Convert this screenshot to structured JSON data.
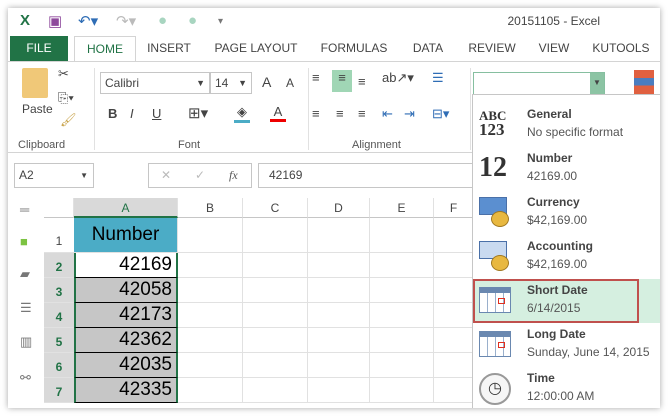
{
  "title": "20151105 - Excel",
  "tabs": [
    "FILE",
    "HOME",
    "INSERT",
    "PAGE LAYOUT",
    "FORMULAS",
    "DATA",
    "REVIEW",
    "VIEW",
    "KUTOOLS"
  ],
  "ribbon": {
    "paste_label": "Paste",
    "groups": [
      "Clipboard",
      "Font",
      "Alignment"
    ],
    "font_name": "Calibri",
    "font_size": "14",
    "bold": "B",
    "italic": "I",
    "underline": "U",
    "font_color_glyph": "A",
    "grow": "A",
    "shrink": "A",
    "number_format_value": ""
  },
  "formula_bar": {
    "name_box": "A2",
    "fx": "fx",
    "cancel": "✕",
    "enter": "✓",
    "value": "42169"
  },
  "grid": {
    "columns": [
      "A",
      "B",
      "C",
      "D",
      "E",
      "F"
    ],
    "rows": [
      "1",
      "2",
      "3",
      "4",
      "5",
      "6",
      "7"
    ],
    "header_cell": "Number",
    "values": [
      "42169",
      "42058",
      "42173",
      "42362",
      "42035",
      "42335"
    ]
  },
  "format_menu": [
    {
      "name": "General",
      "example": "No specific format",
      "icon": "abc-123-icon"
    },
    {
      "name": "Number",
      "example": "42169.00",
      "icon": "number-12-icon"
    },
    {
      "name": "Currency",
      "example": "$42,169.00",
      "icon": "currency-icon"
    },
    {
      "name": "Accounting",
      "example": " $42,169.00",
      "icon": "accounting-icon"
    },
    {
      "name": "Short Date",
      "example": "6/14/2015",
      "icon": "calendar-icon"
    },
    {
      "name": "Long Date",
      "example": "Sunday, June 14, 2015",
      "icon": "calendar-icon"
    },
    {
      "name": "Time",
      "example": "12:00:00 AM",
      "icon": "clock-icon"
    }
  ],
  "icon_glyphs": {
    "abc": "ABC",
    "n123": "123",
    "n12": "12"
  },
  "colors": {
    "accent": "#217346",
    "header_fill": "#4bacc6",
    "selection": "#c6c6c6",
    "highlight": "#d5efe0",
    "highlight_border": "#c0504d"
  }
}
